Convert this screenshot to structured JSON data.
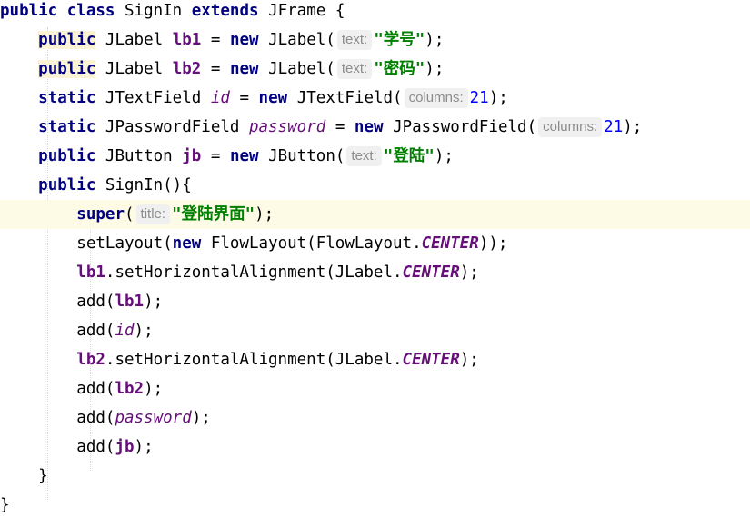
{
  "code": {
    "class_decl": {
      "kw1": "public",
      "kw2": "class",
      "name": "SignIn",
      "kw3": "extends",
      "parent": "JFrame",
      "brace": "{"
    },
    "lb1_decl": {
      "modifier": "public",
      "type": "JLabel",
      "field": "lb1",
      "eq": "=",
      "kw_new": "new",
      "ctor": "JLabel(",
      "hint": "text:",
      "value": "\"学号\"",
      "end": ");"
    },
    "lb2_decl": {
      "modifier": "public",
      "type": "JLabel",
      "field": "lb2",
      "eq": "=",
      "kw_new": "new",
      "ctor": "JLabel(",
      "hint": "text:",
      "value": "\"密码\"",
      "end": ");"
    },
    "id_decl": {
      "modifier": "static",
      "type": "JTextField",
      "field": "id",
      "eq": "=",
      "kw_new": "new",
      "ctor": "JTextField(",
      "hint": "columns:",
      "value": "21",
      "end": ");"
    },
    "pw_decl": {
      "modifier": "static",
      "type": "JPasswordField",
      "field": "password",
      "eq": "=",
      "kw_new": "new",
      "ctor": "JPasswordField(",
      "hint": "columns:",
      "value": "21",
      "end": ");"
    },
    "jb_decl": {
      "modifier": "public",
      "type": "JButton",
      "field": "jb",
      "eq": "=",
      "kw_new": "new",
      "ctor": "JButton(",
      "hint": "text:",
      "value": "\"登陆\"",
      "end": ");"
    },
    "ctor_decl": {
      "modifier": "public",
      "sig": "SignIn(){"
    },
    "super_call": {
      "kw": "super",
      "open": "(",
      "hint": "title:",
      "value": "\"登陆界面\"",
      "end": ");"
    },
    "set_layout": {
      "pre": "setLayout(",
      "kw_new": "new",
      "mid": "FlowLayout(FlowLayout.",
      "const": "CENTER",
      "end": "));"
    },
    "lb1_align": {
      "field": "lb1",
      "mid": ".setHorizontalAlignment(JLabel.",
      "const": "CENTER",
      "end": ");"
    },
    "add_lb1": {
      "pre": "add(",
      "arg": "lb1",
      "end": ");"
    },
    "add_id": {
      "pre": "add(",
      "arg": "id",
      "end": ");"
    },
    "lb2_align": {
      "field": "lb2",
      "mid": ".setHorizontalAlignment(JLabel.",
      "const": "CENTER",
      "end": ");"
    },
    "add_lb2": {
      "pre": "add(",
      "arg": "lb2",
      "end": ");"
    },
    "add_pw": {
      "pre": "add(",
      "arg": "password",
      "end": ");"
    },
    "add_jb": {
      "pre": "add(",
      "arg": "jb",
      "end": ");"
    },
    "ctor_close": "}",
    "class_close": "}"
  }
}
